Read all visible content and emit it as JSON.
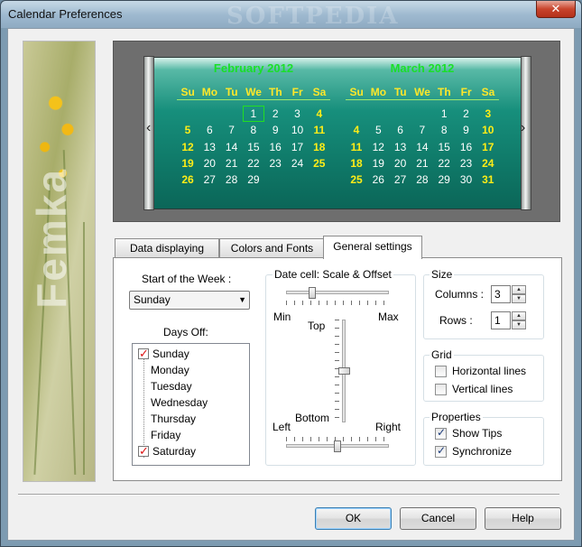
{
  "window": {
    "title": "Calendar Preferences",
    "close_glyph": "✕",
    "watermark": "SOFTPEDIA"
  },
  "side_image": {
    "text": "Femka"
  },
  "preview": {
    "left_arrow": "‹",
    "right_arrow": "›",
    "months": [
      {
        "title": "February 2012",
        "weekdays": [
          "Su",
          "Mo",
          "Tu",
          "We",
          "Th",
          "Fr",
          "Sa"
        ],
        "first_weekday": 3,
        "days": 29,
        "today": 1
      },
      {
        "title": "March 2012",
        "weekdays": [
          "Su",
          "Mo",
          "Tu",
          "We",
          "Th",
          "Fr",
          "Sa"
        ],
        "first_weekday": 4,
        "days": 31,
        "today": null
      }
    ]
  },
  "tabs": [
    {
      "label": "Data displaying",
      "active": false
    },
    {
      "label": "Colors and Fonts",
      "active": false
    },
    {
      "label": "General settings",
      "active": true
    }
  ],
  "general": {
    "start_week_label": "Start of the Week :",
    "start_week_value": "Sunday",
    "days_off_label": "Days Off:",
    "days": [
      {
        "name": "Sunday",
        "checked": true
      },
      {
        "name": "Monday",
        "checked": false
      },
      {
        "name": "Tuesday",
        "checked": false
      },
      {
        "name": "Wednesday",
        "checked": false
      },
      {
        "name": "Thursday",
        "checked": false
      },
      {
        "name": "Friday",
        "checked": false
      },
      {
        "name": "Saturday",
        "checked": true
      }
    ],
    "datecell_label": "Date cell: Scale & Offset",
    "scale_min": "Min",
    "scale_max": "Max",
    "offset_top": "Top",
    "offset_bottom": "Bottom",
    "offset_left": "Left",
    "offset_right": "Right",
    "size_label": "Size",
    "columns_label": "Columns :",
    "columns_value": "3",
    "rows_label": "Rows :",
    "rows_value": "1",
    "grid_label": "Grid",
    "horizontal_lines": "Horizontal lines",
    "vertical_lines": "Vertical lines",
    "properties_label": "Properties",
    "show_tips": "Show Tips",
    "synchronize": "Synchronize"
  },
  "buttons": {
    "ok": "OK",
    "cancel": "Cancel",
    "help": "Help"
  }
}
